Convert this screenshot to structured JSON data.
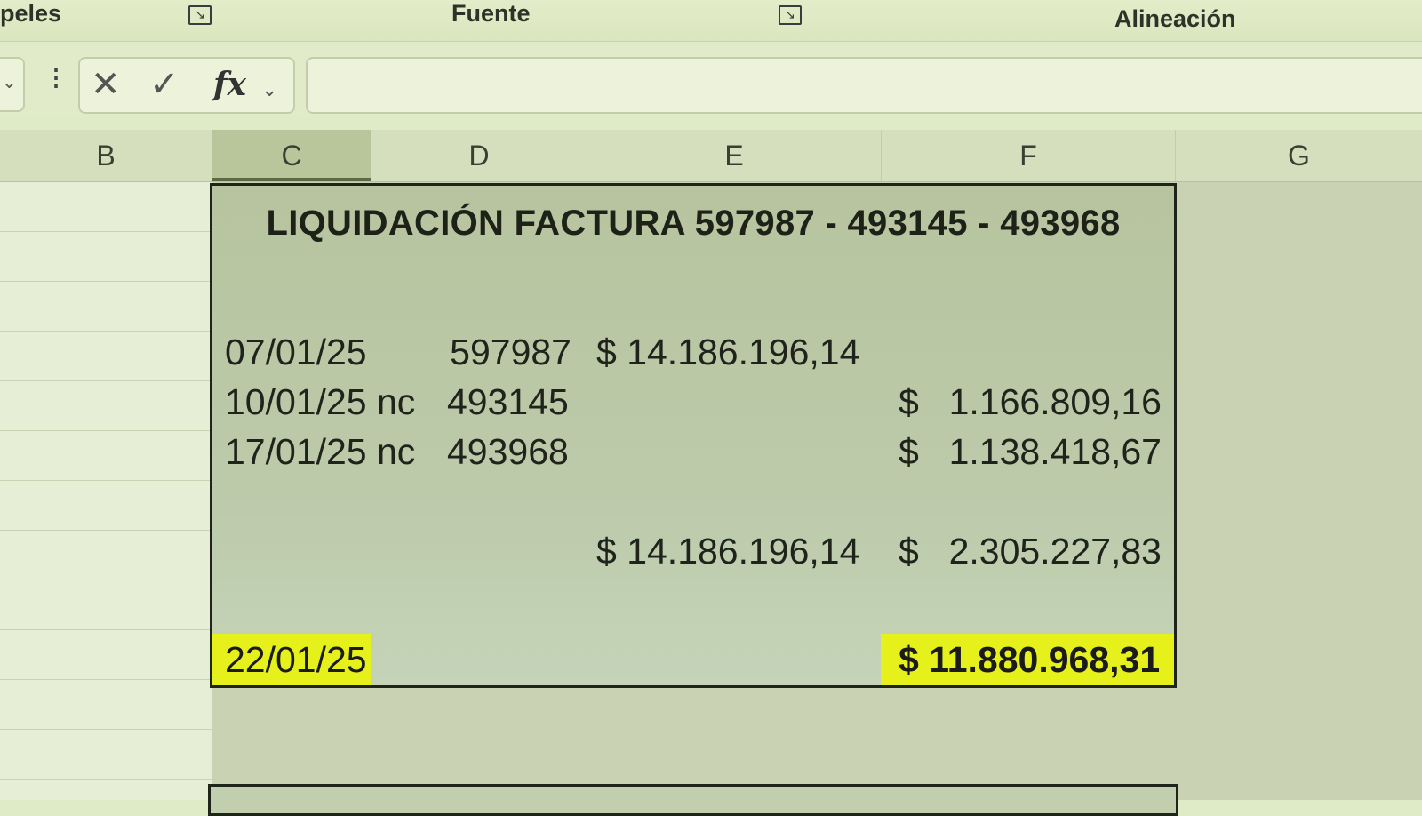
{
  "ribbon": {
    "group_left": "peles",
    "group_font": "Fuente",
    "group_align": "Alineación"
  },
  "formula_bar": {
    "cancel_icon": "close-icon",
    "enter_icon": "check-icon",
    "fx_label": "fx",
    "value": ""
  },
  "columns": [
    "B",
    "C",
    "D",
    "E",
    "F",
    "G"
  ],
  "selected_column": "C",
  "sheet": {
    "title": "LIQUIDACIÓN FACTURA 597987 - 493145 - 493968",
    "rows": [
      {
        "date": "07/01/25",
        "number": "597987",
        "debit": "$ 14.186.196,14",
        "credit_sign": "",
        "credit": ""
      },
      {
        "date": "10/01/25 nc",
        "number": "493145",
        "debit": "",
        "credit_sign": "$",
        "credit": "1.166.809,16"
      },
      {
        "date": "17/01/25 nc",
        "number": "493968",
        "debit": "",
        "credit_sign": "$",
        "credit": "1.138.418,67"
      }
    ],
    "subtotal": {
      "debit": "$ 14.186.196,14",
      "credit_sign": "$",
      "credit": "2.305.227,83"
    },
    "final": {
      "date": "22/01/25",
      "total": "$ 11.880.968,31"
    },
    "highlight_color": "#e6f01a"
  }
}
